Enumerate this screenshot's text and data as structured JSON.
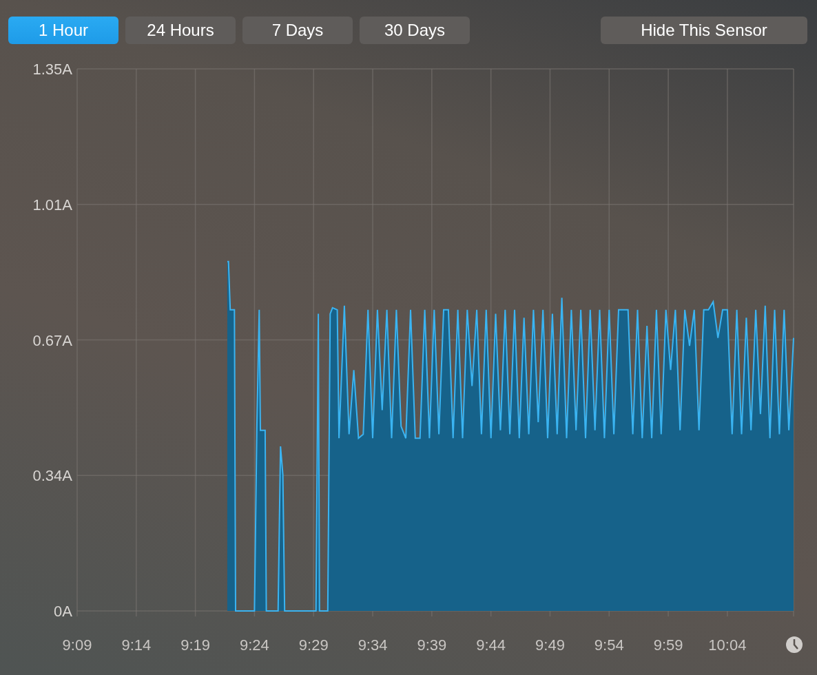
{
  "range_buttons": [
    {
      "label": "1 Hour",
      "selected": true
    },
    {
      "label": "24 Hours",
      "selected": false
    },
    {
      "label": "7 Days",
      "selected": false
    },
    {
      "label": "30 Days",
      "selected": false
    }
  ],
  "hide_button": {
    "label": "Hide This Sensor"
  },
  "chart": {
    "chart_data": {
      "type": "area",
      "grid": true,
      "xlim": [
        549,
        609.6
      ],
      "ylim": [
        0,
        1.35
      ],
      "xticks": [
        {
          "value": 549,
          "label": "9:09"
        },
        {
          "value": 554,
          "label": "9:14"
        },
        {
          "value": 559,
          "label": "9:19"
        },
        {
          "value": 564,
          "label": "9:24"
        },
        {
          "value": 569,
          "label": "9:29"
        },
        {
          "value": 574,
          "label": "9:34"
        },
        {
          "value": 579,
          "label": "9:39"
        },
        {
          "value": 584,
          "label": "9:44"
        },
        {
          "value": 589,
          "label": "9:49"
        },
        {
          "value": 594,
          "label": "9:54"
        },
        {
          "value": 599,
          "label": "9:59"
        },
        {
          "value": 604,
          "label": "10:04"
        }
      ],
      "yticks": [
        {
          "value": 0,
          "label": "0A"
        },
        {
          "value": 0.3375,
          "label": "0.34A"
        },
        {
          "value": 0.675,
          "label": "0.67A"
        },
        {
          "value": 1.0125,
          "label": "1.01A"
        },
        {
          "value": 1.35,
          "label": "1.35A"
        }
      ],
      "x": [
        561.7,
        561.8,
        561.95,
        562.3,
        562.4,
        564,
        564.2,
        564.4,
        564.5,
        564.9,
        565,
        566,
        566.2,
        566.4,
        566.55,
        569.2,
        569.4,
        569.5,
        570.2,
        570.4,
        570.6,
        571,
        571.15,
        571.6,
        572.0,
        572.4,
        572.8,
        573.2,
        573.6,
        574.0,
        574.4,
        574.8,
        575.2,
        575.6,
        576.0,
        576.4,
        576.8,
        577.2,
        577.6,
        578.0,
        578.4,
        578.8,
        579.2,
        579.6,
        580.0,
        580.4,
        580.8,
        581.2,
        581.6,
        582.0,
        582.4,
        582.8,
        583.2,
        583.6,
        584.0,
        584.4,
        584.8,
        585.2,
        585.6,
        586.0,
        586.4,
        586.8,
        587.2,
        587.6,
        588.0,
        588.4,
        588.8,
        589.2,
        589.6,
        590.0,
        590.4,
        590.8,
        591.2,
        591.6,
        592.0,
        592.4,
        592.8,
        593.2,
        593.6,
        594.0,
        594.4,
        594.8,
        595.2,
        595.6,
        596.0,
        596.4,
        596.8,
        597.2,
        597.6,
        598.0,
        598.4,
        598.8,
        599.2,
        599.6,
        600.0,
        600.4,
        600.8,
        601.2,
        601.6,
        602.0,
        602.4,
        602.8,
        603.2,
        603.6,
        604.0,
        604.4,
        604.8,
        605.2,
        605.6,
        606.0,
        606.4,
        606.8,
        607.2,
        607.6,
        608.0,
        608.4,
        608.8,
        609.2,
        609.6
      ],
      "series": [
        {
          "color": "#3ab4f2",
          "values": [
            0.87,
            0.87,
            0.75,
            0.75,
            0,
            0,
            0.46,
            0.75,
            0.45,
            0.45,
            0,
            0,
            0.41,
            0.34,
            0,
            0,
            0.74,
            0,
            0,
            0.74,
            0.755,
            0.75,
            0.43,
            0.76,
            0.44,
            0.6,
            0.43,
            0.44,
            0.75,
            0.43,
            0.75,
            0.5,
            0.75,
            0.43,
            0.75,
            0.46,
            0.43,
            0.75,
            0.43,
            0.43,
            0.75,
            0.43,
            0.75,
            0.44,
            0.75,
            0.75,
            0.43,
            0.75,
            0.43,
            0.75,
            0.56,
            0.75,
            0.44,
            0.75,
            0.43,
            0.74,
            0.45,
            0.75,
            0.44,
            0.75,
            0.43,
            0.73,
            0.44,
            0.75,
            0.47,
            0.75,
            0.43,
            0.74,
            0.44,
            0.78,
            0.43,
            0.75,
            0.45,
            0.75,
            0.43,
            0.75,
            0.45,
            0.75,
            0.43,
            0.75,
            0.44,
            0.75,
            0.75,
            0.75,
            0.44,
            0.75,
            0.43,
            0.71,
            0.43,
            0.75,
            0.44,
            0.75,
            0.6,
            0.75,
            0.45,
            0.75,
            0.66,
            0.75,
            0.45,
            0.75,
            0.75,
            0.77,
            0.68,
            0.75,
            0.75,
            0.44,
            0.75,
            0.44,
            0.73,
            0.45,
            0.75,
            0.49,
            0.76,
            0.43,
            0.75,
            0.44,
            0.75,
            0.45,
            0.68
          ]
        }
      ]
    }
  }
}
